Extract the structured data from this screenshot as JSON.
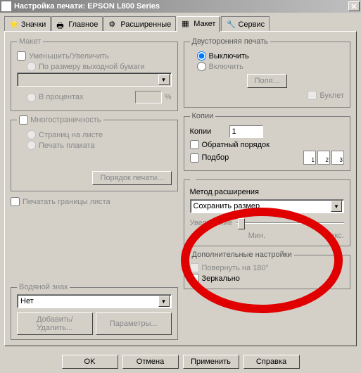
{
  "window": {
    "title": "Настройка печати: EPSON L800 Series"
  },
  "tabs": {
    "icons": "Значки",
    "main": "Главное",
    "advanced": "Расширенные",
    "layout": "Макет",
    "service": "Сервис"
  },
  "left": {
    "layout_group": "Макет",
    "reduce_enlarge": "Уменьшить/Увеличить",
    "fit_output": "По размеру выходной бумаги",
    "percent": "В процентах",
    "percent_unit": "%",
    "multipage_group": "Многостраничность",
    "pages_per_sheet": "Страниц на листе",
    "poster": "Печать плаката",
    "print_order_btn": "Порядок печати...",
    "print_borders": "Печатать границы листа",
    "watermark_group": "Водяной знак",
    "watermark_value": "Нет",
    "add_remove_btn": "Добавить/Удалить...",
    "params_btn": "Параметры..."
  },
  "right": {
    "duplex_group": "Двусторонняя печать",
    "duplex_off": "Выключить",
    "duplex_on": "Включить",
    "margins_btn": "Поля...",
    "booklet": "Буклет",
    "copies_group": "Копии",
    "copies_label": "Копии",
    "copies_value": "1",
    "reverse_order": "Обратный порядок",
    "collate": "Подбор",
    "method_label": "Метод расширения",
    "method_value": "Сохранить размер",
    "enlarge_label": "Увеличение",
    "slider_min": "Мин.",
    "slider_max": "Макс.",
    "extra_group": "Дополнительные настройки",
    "rotate180": "Повернуть на 180°",
    "mirror": "Зеркально"
  },
  "buttons": {
    "ok": "OK",
    "cancel": "Отмена",
    "apply": "Применить",
    "help": "Справка"
  }
}
